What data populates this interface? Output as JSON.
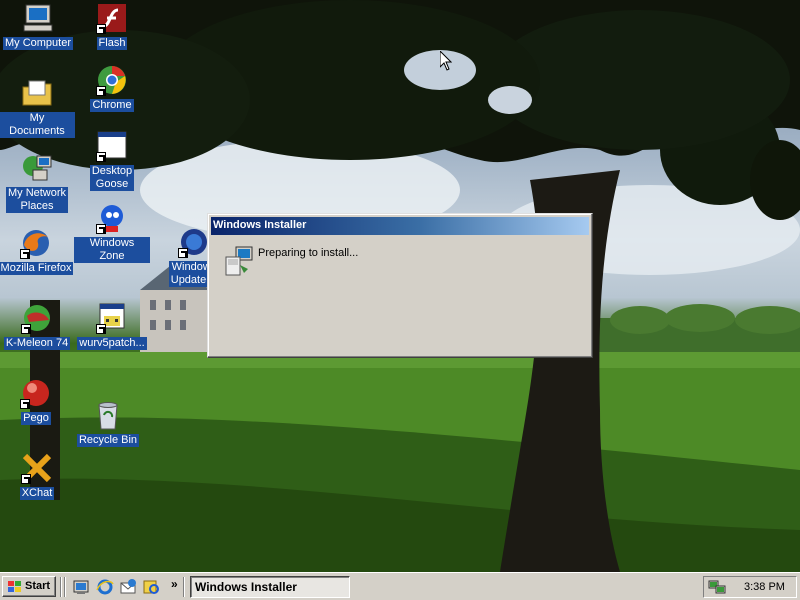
{
  "desktop": {
    "icons": [
      {
        "label": "My Computer",
        "icon": "my-computer-icon"
      },
      {
        "label": "My Documents",
        "icon": "my-documents-icon"
      },
      {
        "label": "My Network\nPlaces",
        "icon": "network-places-icon"
      },
      {
        "label": "Mozilla Firefox",
        "icon": "firefox-icon"
      },
      {
        "label": "K-Meleon 74",
        "icon": "kmeleon-icon"
      },
      {
        "label": "Pego",
        "icon": "pego-icon"
      },
      {
        "label": "XChat",
        "icon": "xchat-icon"
      },
      {
        "label": "Flash",
        "icon": "flash-icon"
      },
      {
        "label": "Chrome",
        "icon": "chrome-icon"
      },
      {
        "label": "Desktop\nGoose",
        "icon": "desktop-goose-icon"
      },
      {
        "label": "Windows Zone",
        "icon": "windows-zone-icon"
      },
      {
        "label": "wurv5patch...",
        "icon": "wurv5patch-icon"
      },
      {
        "label": "Recycle Bin",
        "icon": "recycle-bin-icon"
      },
      {
        "label": "Windows\nUpdate R",
        "icon": "windows-update-icon"
      }
    ]
  },
  "dialog": {
    "title": "Windows Installer",
    "message": "Preparing to install...",
    "icon": "installer-icon"
  },
  "taskbar": {
    "start_label": "Start",
    "quick_launch": [
      "show-desktop-icon",
      "internet-explorer-icon",
      "outlook-express-icon",
      "media-icon"
    ],
    "chevron": "»",
    "tasks": [
      {
        "label": "Windows Installer"
      }
    ],
    "clock": "3:38 PM"
  },
  "colors": {
    "title_gradient_start": "#0a246a",
    "title_gradient_end": "#a6caf0",
    "selection_label": "#1c4e9e",
    "face": "#d4d0c8"
  }
}
